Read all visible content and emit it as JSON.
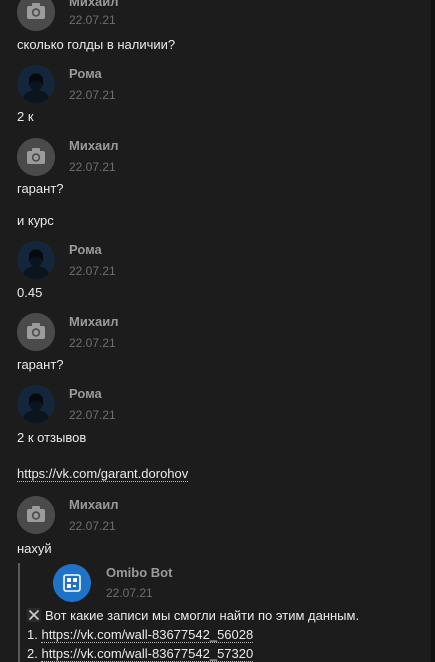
{
  "messages": [
    {
      "author": "Михаил",
      "date": "22.07.21",
      "avatar": "camera-icon",
      "lines": [
        "сколько голды в наличии?"
      ]
    },
    {
      "author": "Рома",
      "date": "22.07.21",
      "avatar": "user-photo",
      "lines": [
        "2 к"
      ]
    },
    {
      "author": "Михаил",
      "date": "22.07.21",
      "avatar": "camera-icon",
      "lines": [
        "гарант?",
        "и курс"
      ]
    },
    {
      "author": "Рома",
      "date": "22.07.21",
      "avatar": "user-photo",
      "lines": [
        "0.45"
      ]
    },
    {
      "author": "Михаил",
      "date": "22.07.21",
      "avatar": "camera-icon",
      "lines": [
        "гарант?"
      ]
    },
    {
      "author": "Рома",
      "date": "22.07.21",
      "avatar": "user-photo",
      "lines": [
        "2 к отзывов",
        "https://vk.com/garant.dorohov"
      ]
    },
    {
      "author": "Михаил",
      "date": "22.07.21",
      "avatar": "camera-icon",
      "lines": [
        "нахуй"
      ]
    }
  ],
  "bot": {
    "author": "Omibo Bot",
    "date": "22.07.21",
    "intro": "Вот какие записи мы смогли найти по этим данным.",
    "results": [
      {
        "num": "1.",
        "url": "https://vk.com/wall-83677542_56028"
      },
      {
        "num": "2.",
        "url": "https://vk.com/wall-83677542_57320"
      }
    ]
  },
  "colors": {
    "background": "#1c1c1c",
    "text": "#eaeaea",
    "name": "#9a9a9a",
    "date": "#6e6e6e",
    "bot_avatar": "#1e72c8"
  }
}
